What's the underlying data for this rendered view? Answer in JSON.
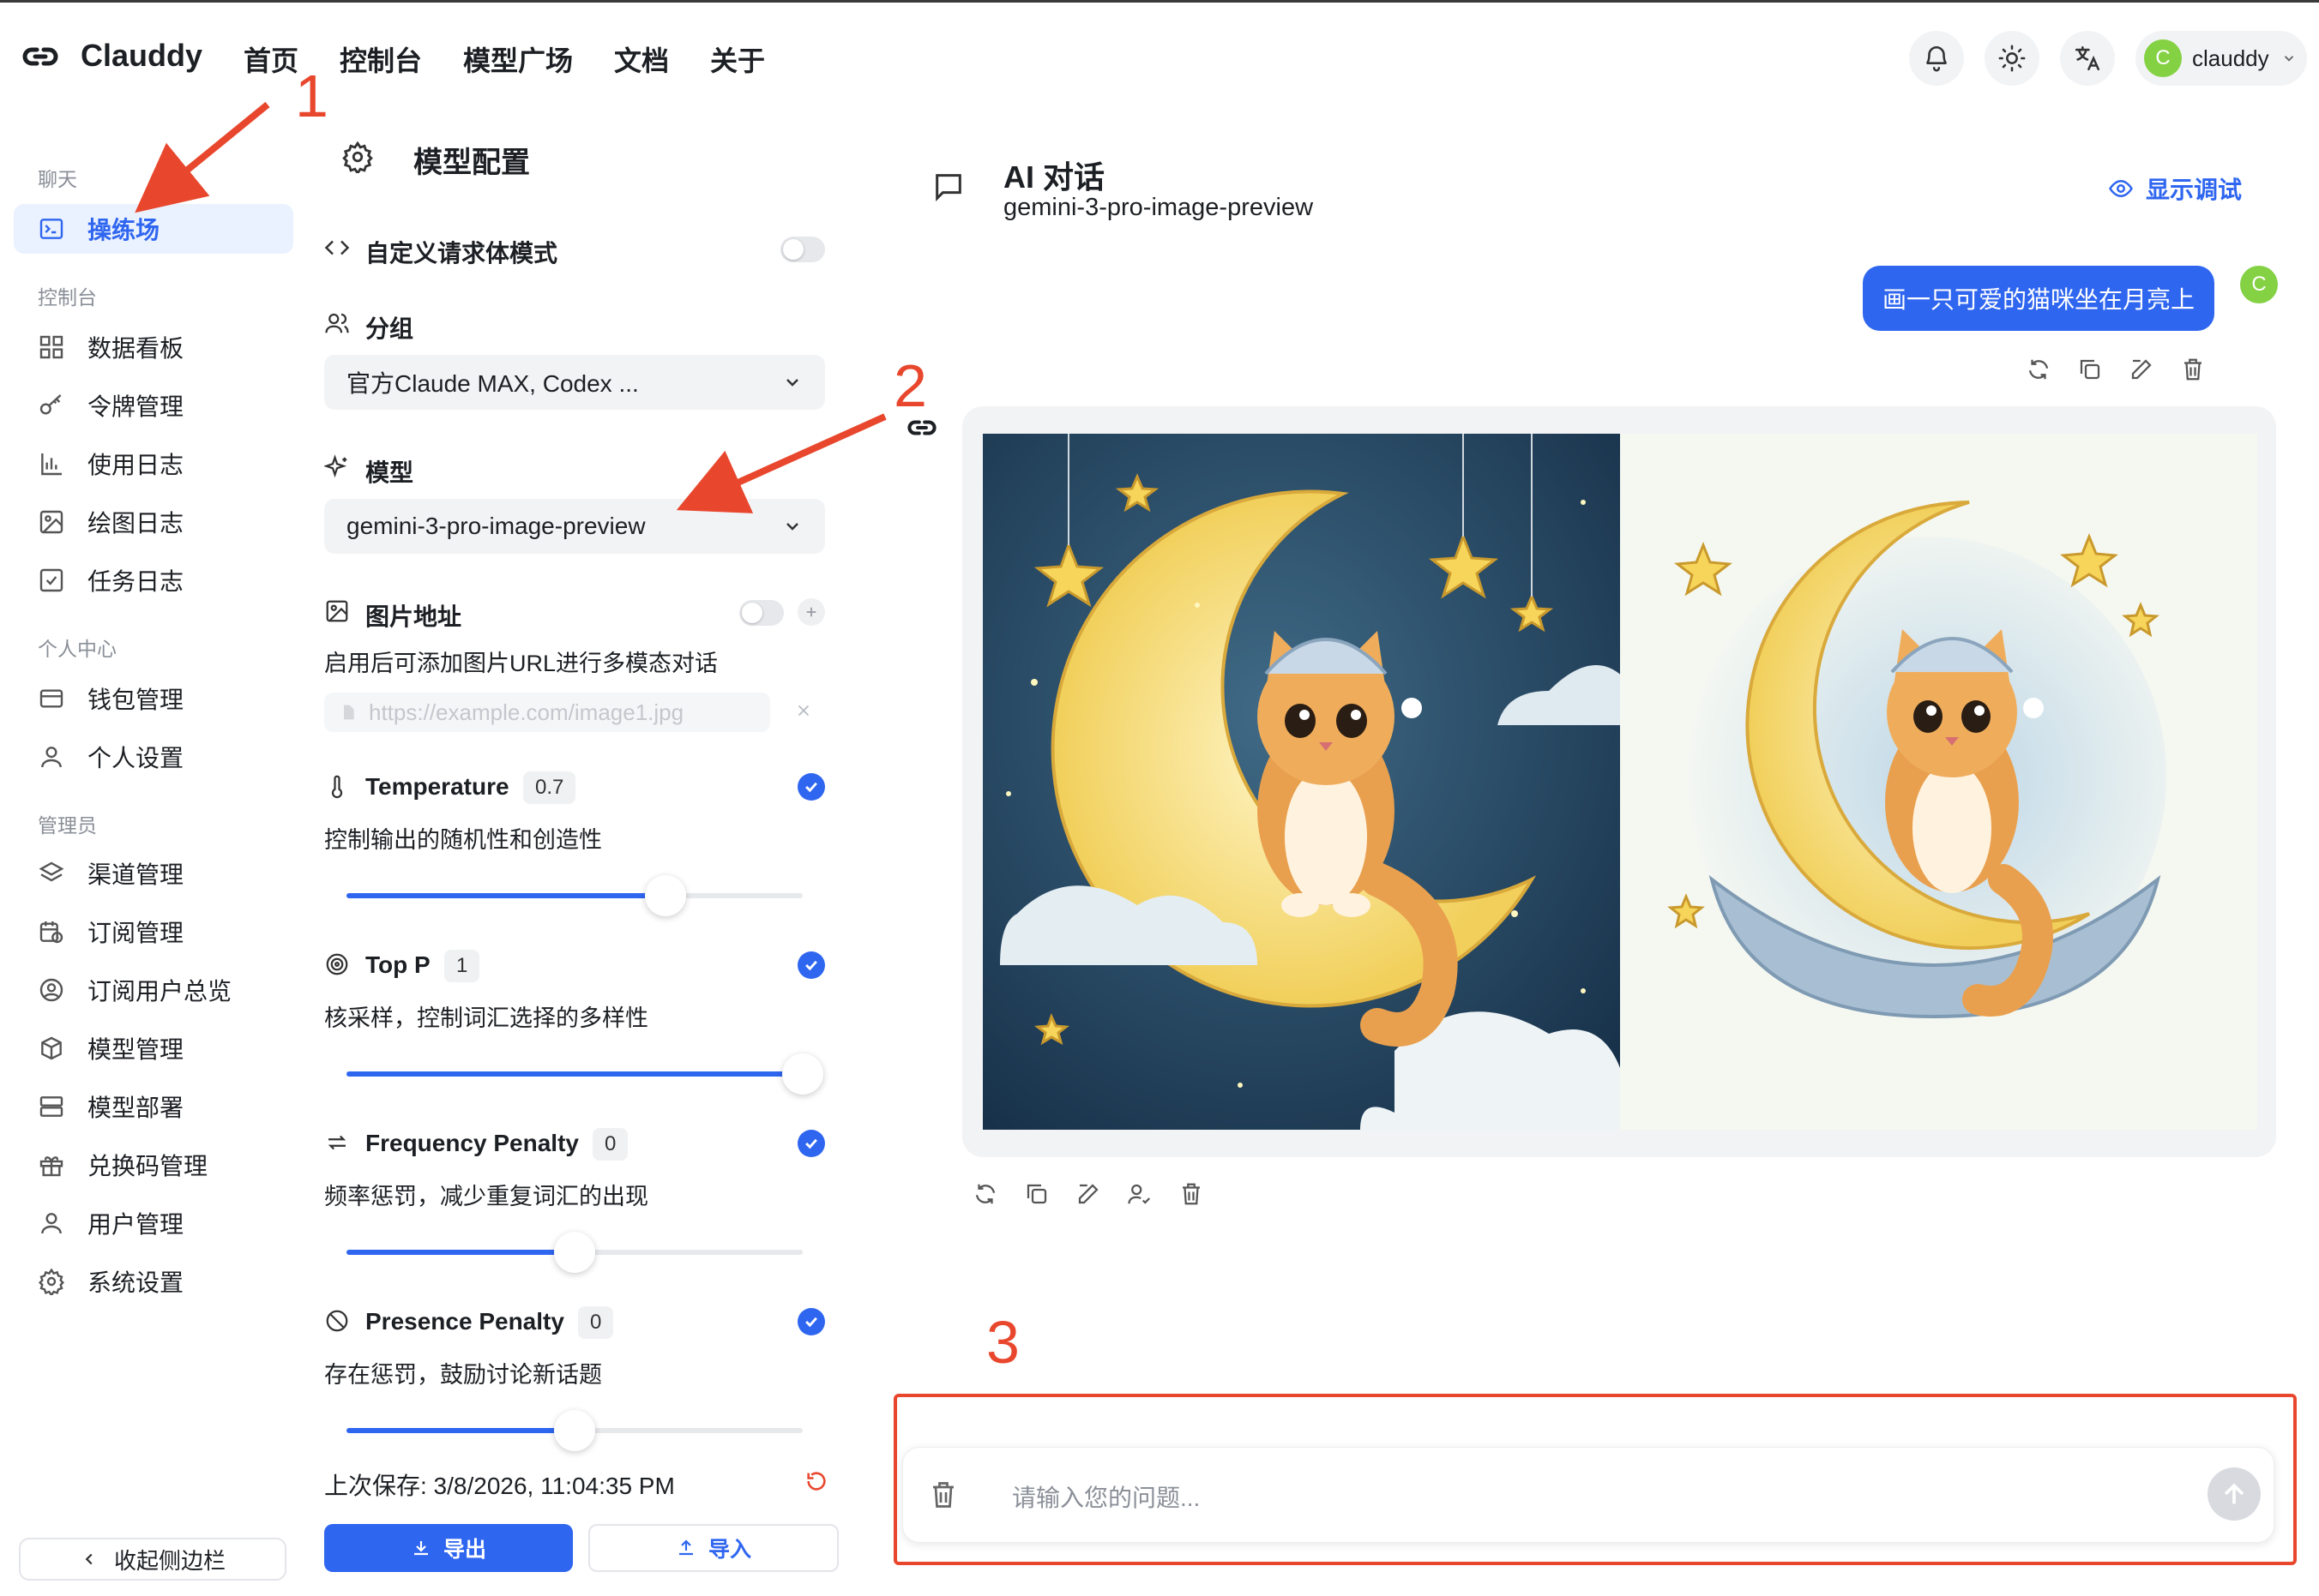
{
  "app": {
    "name": "Clauddy"
  },
  "nav": [
    "首页",
    "控制台",
    "模型广场",
    "文档",
    "关于"
  ],
  "user": {
    "initial": "C",
    "name": "clauddy"
  },
  "sidebar": {
    "sections": [
      {
        "title": "聊天",
        "items": [
          {
            "label": "操练场",
            "icon": "playground-icon",
            "active": true
          }
        ]
      },
      {
        "title": "控制台",
        "items": [
          {
            "label": "数据看板",
            "icon": "dashboard-icon"
          },
          {
            "label": "令牌管理",
            "icon": "key-icon"
          },
          {
            "label": "使用日志",
            "icon": "bar-chart-icon"
          },
          {
            "label": "绘图日志",
            "icon": "image-icon"
          },
          {
            "label": "任务日志",
            "icon": "checkbox-icon"
          }
        ]
      },
      {
        "title": "个人中心",
        "items": [
          {
            "label": "钱包管理",
            "icon": "wallet-icon"
          },
          {
            "label": "个人设置",
            "icon": "user-icon"
          }
        ]
      },
      {
        "title": "管理员",
        "items": [
          {
            "label": "渠道管理",
            "icon": "layers-icon"
          },
          {
            "label": "订阅管理",
            "icon": "calendar-clock-icon"
          },
          {
            "label": "订阅用户总览",
            "icon": "user-circle-icon"
          },
          {
            "label": "模型管理",
            "icon": "box-icon"
          },
          {
            "label": "模型部署",
            "icon": "server-icon"
          },
          {
            "label": "兑换码管理",
            "icon": "gift-icon"
          },
          {
            "label": "用户管理",
            "icon": "user-icon"
          },
          {
            "label": "系统设置",
            "icon": "gear-icon"
          }
        ]
      }
    ],
    "collapse_label": "收起侧边栏"
  },
  "config": {
    "title": "模型配置",
    "custom_body_label": "自定义请求体模式",
    "group_label": "分组",
    "group_value": "官方Claude MAX, Codex ...",
    "model_label": "模型",
    "model_value": "gemini-3-pro-image-preview",
    "image_url_label": "图片地址",
    "image_url_desc": "启用后可添加图片URL进行多模态对话",
    "image_url_placeholder": "https://example.com/image1.jpg",
    "params": [
      {
        "label": "Temperature",
        "value": "0.7",
        "desc": "控制输出的随机性和创造性",
        "fraction": 0.7,
        "icon": "thermometer-icon"
      },
      {
        "label": "Top P",
        "value": "1",
        "desc": "核采样，控制词汇选择的多样性",
        "fraction": 1.0,
        "icon": "target-icon"
      },
      {
        "label": "Frequency Penalty",
        "value": "0",
        "desc": "频率惩罚，减少重复词汇的出现",
        "fraction": 0.5,
        "icon": "repeat-icon"
      },
      {
        "label": "Presence Penalty",
        "value": "0",
        "desc": "存在惩罚，鼓励讨论新话题",
        "fraction": 0.5,
        "icon": "ban-icon"
      }
    ],
    "last_saved": "上次保存: 3/8/2026, 11:04:35 PM",
    "export_label": "导出",
    "import_label": "导入"
  },
  "chat": {
    "title": "AI 对话",
    "model": "gemini-3-pro-image-preview",
    "debug_label": "显示调试",
    "user_message": "画一只可爱的猫咪坐在月亮上",
    "input_placeholder": "请输入您的问题..."
  },
  "annotations": [
    "1",
    "2",
    "3"
  ],
  "colors": {
    "accent": "#2f66f0",
    "annotation": "#e8472d",
    "avatar": "#84d144"
  }
}
